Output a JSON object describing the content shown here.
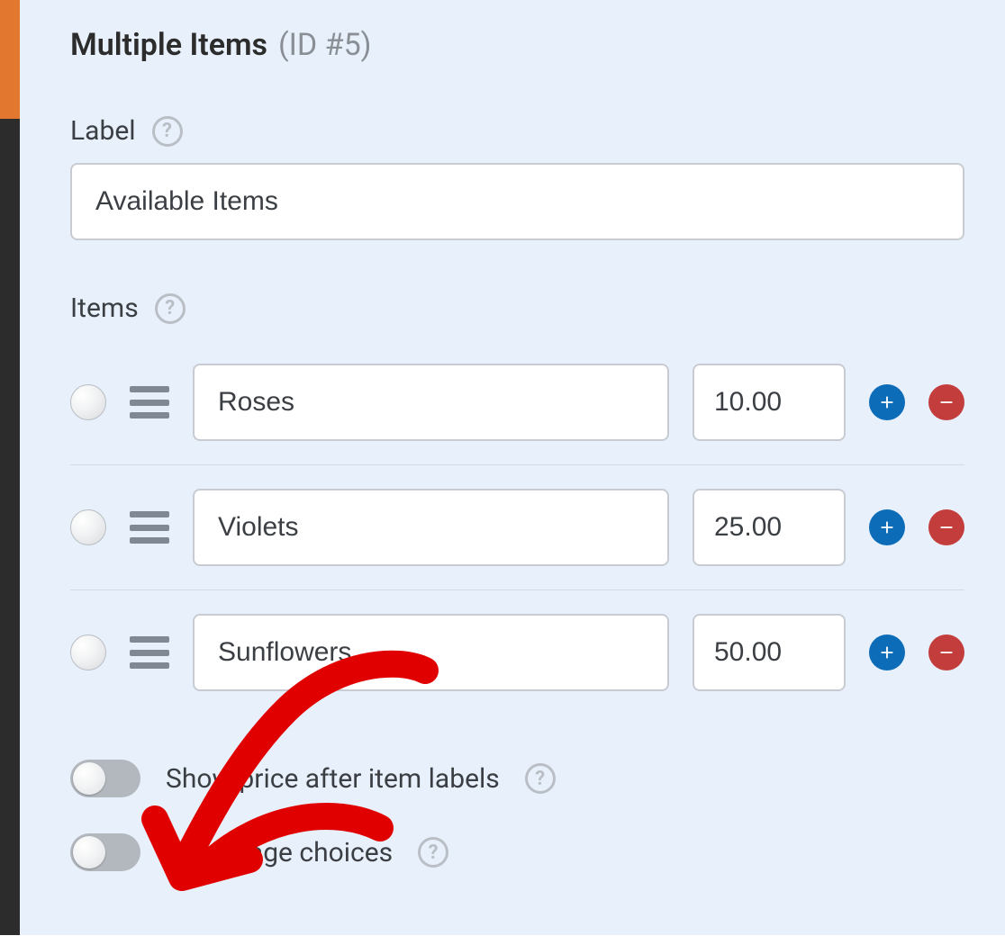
{
  "header": {
    "title": "Multiple Items",
    "id_text": "(ID #5)"
  },
  "label_section": {
    "caption": "Label",
    "value": "Available Items"
  },
  "items_section": {
    "caption": "Items",
    "rows": [
      {
        "name": "Roses",
        "price": "10.00"
      },
      {
        "name": "Violets",
        "price": "25.00"
      },
      {
        "name": "Sunflowers",
        "price": "50.00"
      }
    ]
  },
  "toggles": {
    "show_price": {
      "label": "Show price after item labels",
      "on": false
    },
    "image_choices": {
      "label": "Use image choices",
      "on": false
    }
  }
}
